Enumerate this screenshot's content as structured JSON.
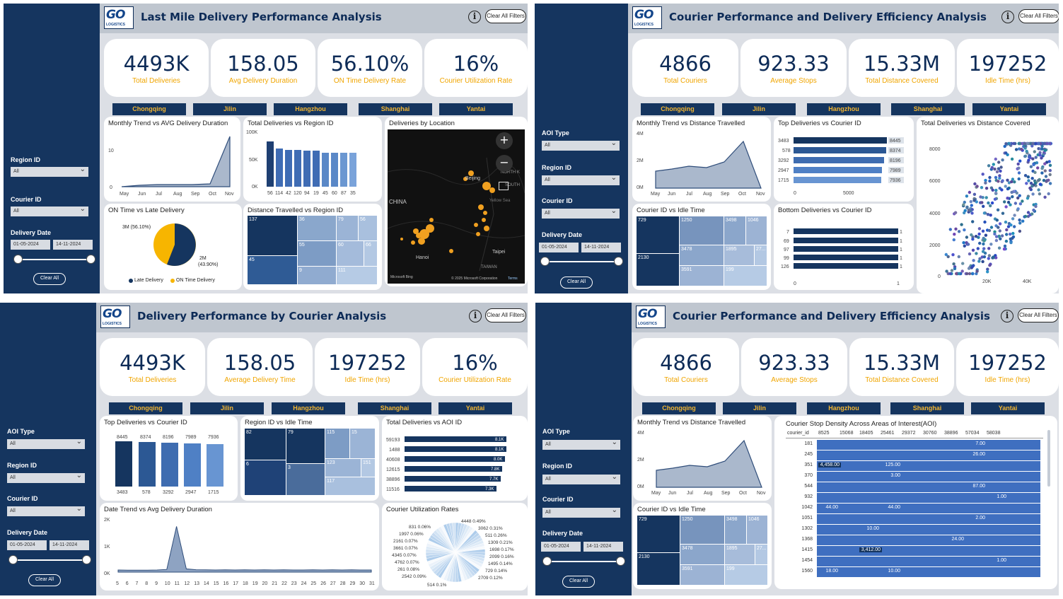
{
  "q1": {
    "title": "Last Mile Delivery Performance Analysis",
    "clear_filters": "Clear All Filters",
    "kpis": [
      {
        "value": "4493K",
        "label": "Total Deliveries"
      },
      {
        "value": "158.05",
        "label": "Avg Delivery Duration"
      },
      {
        "value": "56.10%",
        "label": "ON Time Delivery Rate"
      },
      {
        "value": "16%",
        "label": "Courier Utilization Rate"
      }
    ],
    "cities": [
      "Chongqing",
      "Jilin",
      "Hangzhou",
      "Shanghai",
      "Yantai"
    ],
    "filters": {
      "region_label": "Region ID",
      "region_value": "All",
      "courier_label": "Courier ID",
      "courier_value": "All",
      "date_label": "Delivery Date",
      "date_from": "01-05-2024",
      "date_to": "14-11-2024",
      "clear": "Clear All"
    },
    "monthly_title": "Monthly Trend vs AVG Delivery Duration",
    "region_title": "Total Deliveries vs Region ID",
    "map_title": "Deliveries by Location",
    "ontime_title": "ON Time vs Late Delivery",
    "dist_title": "Distance Travelled vs Region ID",
    "map_labels": {
      "china": "CHINA",
      "beijing": "Beijing",
      "north": "NORTH K",
      "south": "SOUTH",
      "yellow": "Yellow Sea",
      "taipei": "Taipei",
      "taiwan": "TAIWAN",
      "hanoi": "Hanoi",
      "copy": "© 2025 Microsoft Corporation",
      "terms": "Terms",
      "bing": "Microsoft Bing"
    },
    "pie": {
      "late_label": "3M (56.10%)",
      "ontime_label1": "2M",
      "ontime_label2": "(43.90%)",
      "legend_late": "Late Delivery",
      "legend_ontime": "ON Time Delivery"
    },
    "tree": {
      "a": "137",
      "b": "45",
      "c": "36",
      "d": "79",
      "e": "56",
      "f": "55",
      "g": "60",
      "h": "66",
      "i": "9",
      "j": "111"
    }
  },
  "q2": {
    "title": "Courier Performance and Delivery Efficiency Analysis",
    "clear_filters": "Clear All Filters",
    "kpis": [
      {
        "value": "4866",
        "label": "Total Couriers"
      },
      {
        "value": "923.33",
        "label": "Average Stops"
      },
      {
        "value": "15.33M",
        "label": "Total Distance Covered"
      },
      {
        "value": "197252",
        "label": "Idle Time (hrs)"
      }
    ],
    "cities": [
      "Chongqing",
      "Jilin",
      "Hangzhou",
      "Shanghai",
      "Yantai"
    ],
    "filters": {
      "aoi_label": "AOI Type",
      "aoi_value": "All",
      "region_label": "Region ID",
      "region_value": "All",
      "courier_label": "Courier ID",
      "courier_value": "All",
      "date_label": "Delivery Date",
      "date_from": "01-05-2024",
      "date_to": "14-11-2024",
      "clear": "Clear All"
    },
    "monthly_title": "Monthly Trend vs Distance Travelled",
    "top_title": "Top Deliveries vs Courier ID",
    "scatter_title": "Total Deliveries vs Distance Covered",
    "idle_title": "Courier ID vs Idle Time",
    "bottom_title": "Bottom Deliveries vs Courier ID",
    "tree": {
      "a": "729",
      "b": "2130",
      "c": "1250",
      "d": "3498",
      "e": "1046",
      "f": "3478",
      "g": "1895",
      "h": "27...",
      "i": "3591",
      "j": "199"
    }
  },
  "q3": {
    "title": "Delivery Performance by Courier Analysis",
    "clear_filters": "Clear All Filters",
    "kpis": [
      {
        "value": "4493K",
        "label": "Total Deliveries"
      },
      {
        "value": "158.05",
        "label": "Average Delivery Time"
      },
      {
        "value": "197252",
        "label": "Idle Time (hrs)"
      },
      {
        "value": "16%",
        "label": "Courier Utilization Rate"
      }
    ],
    "cities": [
      "Chongqing",
      "Jilin",
      "Hangzhou",
      "Shanghai",
      "Yantai"
    ],
    "filters": {
      "aoi_label": "AOI Type",
      "aoi_value": "All",
      "region_label": "Region ID",
      "region_value": "All",
      "courier_label": "Courier ID",
      "courier_value": "All",
      "date_label": "Delivery Date",
      "date_from": "01-05-2024",
      "date_to": "14-11-2024",
      "clear": "Clear All"
    },
    "top_title": "Top Deliveries vs Courier ID",
    "idle_title": "Region ID vs Idle Time",
    "aoi_title": "Total Deliveries vs AOI ID",
    "date_title": "Date Trend vs Avg Delivery Duration",
    "util_title": "Courier Utilization Rates",
    "tree": {
      "a": "82",
      "b": "6",
      "c": "79",
      "d": "3",
      "e": "115",
      "f": "15",
      "g": "123",
      "h": "151",
      "i": "117"
    },
    "util_labels_left": [
      "831 0.06%",
      "1997 0.06%",
      "2161 0.07%",
      "3661 0.07%",
      "4345 0.07%",
      "4762 0.07%",
      "261 0.08%",
      "2542 0.09%",
      "514 0.1%"
    ],
    "util_labels_right": [
      "4448 0.49%",
      "3062 0.31%",
      "511 0.26%",
      "1309 0.21%",
      "1698 0.17%",
      "2099 0.16%",
      "1495 0.14%",
      "729 0.14%",
      "2709 0.12%"
    ]
  },
  "q4": {
    "title": "Courier Performance and Delivery Efficiency Analysis",
    "clear_filters": "Clear All Filters",
    "kpis": [
      {
        "value": "4866",
        "label": "Total Couriers"
      },
      {
        "value": "923.33",
        "label": "Average Stops"
      },
      {
        "value": "15.33M",
        "label": "Total Distance Covered"
      },
      {
        "value": "197252",
        "label": "Idle Time (hrs)"
      }
    ],
    "cities": [
      "Chongqing",
      "Jilin",
      "Hangzhou",
      "Shanghai",
      "Yantai"
    ],
    "filters": {
      "aoi_label": "AOI Type",
      "aoi_value": "All",
      "region_label": "Region ID",
      "region_value": "All",
      "courier_label": "Courier ID",
      "courier_value": "All",
      "date_label": "Delivery Date",
      "date_from": "01-05-2024",
      "date_to": "14-11-2024",
      "clear": "Clear All"
    },
    "monthly_title": "Monthly Trend vs Distance Travelled",
    "idle_title": "Courier ID vs Idle Time",
    "matrix_title": "Courier Stop Density Across Areas of Interest(AOI)",
    "matrix_cols": [
      "courier_id",
      "8525",
      "15068",
      "18405",
      "25461",
      "29372",
      "30760",
      "38896",
      "57034",
      "58038"
    ],
    "matrix_rows": [
      {
        "id": "181",
        "cells": [
          [
            "7.00",
            8
          ]
        ]
      },
      {
        "id": "245",
        "cells": [
          [
            "26.00",
            8
          ]
        ]
      },
      {
        "id": "351",
        "cells": [
          [
            "4,458.00",
            1
          ],
          [
            "125.00",
            4
          ]
        ]
      },
      {
        "id": "370",
        "cells": [
          [
            "3.00",
            4
          ]
        ]
      },
      {
        "id": "544",
        "cells": [
          [
            "87.00",
            8
          ]
        ]
      },
      {
        "id": "932",
        "cells": [
          [
            "1.00",
            9
          ]
        ]
      },
      {
        "id": "1042",
        "cells": [
          [
            "44.00",
            1
          ],
          [
            "44.00",
            4
          ]
        ]
      },
      {
        "id": "1051",
        "cells": [
          [
            "2.00",
            8
          ]
        ]
      },
      {
        "id": "1302",
        "cells": [
          [
            "10.00",
            3
          ]
        ]
      },
      {
        "id": "1368",
        "cells": [
          [
            "24.00",
            7
          ]
        ]
      },
      {
        "id": "1415",
        "cells": [
          [
            "3,412.00",
            3
          ]
        ]
      },
      {
        "id": "1454",
        "cells": [
          [
            "1.00",
            9
          ]
        ]
      },
      {
        "id": "1560",
        "cells": [
          [
            "18.00",
            1
          ],
          [
            "10.00",
            4
          ]
        ]
      }
    ],
    "tree": {
      "a": "729",
      "b": "2130",
      "c": "1250",
      "d": "3498",
      "e": "1046",
      "f": "3478",
      "g": "1895",
      "h": "27...",
      "i": "3591",
      "j": "199"
    }
  },
  "chart_data": [
    {
      "type": "area",
      "title": "Monthly Trend vs AVG Delivery Duration",
      "categories": [
        "May",
        "Jun",
        "Jul",
        "Aug",
        "Sep",
        "Oct",
        "Nov"
      ],
      "values": [
        0.5,
        0.6,
        0.6,
        0.6,
        0.7,
        0.8,
        13
      ],
      "ylim": [
        0,
        14
      ],
      "yticks": [
        "0",
        "10"
      ]
    },
    {
      "type": "bar",
      "title": "Total Deliveries vs Region ID",
      "categories": [
        "56",
        "114",
        "42",
        "120",
        "94",
        "19",
        "45",
        "60",
        "87",
        "35"
      ],
      "values": [
        88,
        75,
        72,
        72,
        70,
        70,
        66,
        66,
        66,
        66
      ],
      "ylim": [
        0,
        100
      ],
      "yticks": [
        "0K",
        "50K",
        "100K"
      ]
    },
    {
      "type": "pie",
      "title": "ON Time vs Late Delivery",
      "values": [
        56.1,
        43.9
      ],
      "labels": [
        "Late Delivery",
        "ON Time Delivery"
      ]
    },
    {
      "type": "area",
      "title": "Monthly Trend vs Distance Travelled",
      "categories": [
        "May",
        "Jun",
        "Jul",
        "Aug",
        "Sep",
        "Oct",
        "Nov"
      ],
      "values": [
        1.3,
        1.4,
        1.6,
        1.5,
        1.8,
        2.7,
        0
      ],
      "ylim": [
        0,
        4
      ],
      "yticks": [
        "0M",
        "2M",
        "4M"
      ]
    },
    {
      "type": "bar",
      "title": "Top Deliveries vs Courier ID",
      "categories": [
        "3483",
        "578",
        "3292",
        "2947",
        "1715"
      ],
      "values": [
        8445,
        8374,
        8196,
        7989,
        7936
      ],
      "xticks": [
        "0",
        "5000"
      ]
    },
    {
      "type": "bar",
      "title": "Bottom Deliveries vs Courier ID",
      "categories": [
        "7",
        "69",
        "97",
        "99",
        "126"
      ],
      "values": [
        1,
        1,
        1,
        1,
        1
      ],
      "xticks": [
        "0",
        "1"
      ]
    },
    {
      "type": "scatter",
      "title": "Total Deliveries vs Distance Covered",
      "yticks": [
        "0",
        "2000",
        "4000",
        "6000",
        "8000"
      ],
      "xticks": [
        "20K",
        "40K"
      ]
    },
    {
      "type": "bar",
      "title": "Top Deliveries vs Courier ID",
      "categories": [
        "3483",
        "578",
        "3292",
        "2947",
        "1715"
      ],
      "values": [
        8445,
        8374,
        8196,
        7989,
        7936
      ]
    },
    {
      "type": "bar",
      "title": "Total Deliveries vs AOI ID",
      "categories": [
        "59193",
        "1488",
        "40608",
        "12615",
        "38896",
        "11516"
      ],
      "values": [
        8.1,
        8.1,
        8.0,
        7.8,
        7.7,
        7.3
      ],
      "labels": [
        "8.1K",
        "8.1K",
        "8.0K",
        "7.8K",
        "7.7K",
        "7.3K"
      ]
    },
    {
      "type": "line",
      "title": "Date Trend vs Avg Delivery Duration",
      "categories": [
        "5",
        "6",
        "7",
        "8",
        "9",
        "10",
        "11",
        "12",
        "13",
        "14",
        "15",
        "16",
        "17",
        "18",
        "19",
        "20",
        "21",
        "22",
        "23",
        "24",
        "25",
        "26",
        "27",
        "28",
        "29",
        "30",
        "31"
      ],
      "values": [
        80,
        75,
        70,
        75,
        80,
        100,
        1700,
        120,
        90,
        85,
        80,
        85,
        80,
        85,
        80,
        85,
        80,
        85,
        80,
        80,
        85,
        80,
        85,
        80,
        85,
        80,
        80
      ],
      "ylim": [
        0,
        2000
      ],
      "yticks": [
        "0K",
        "1K",
        "2K"
      ]
    }
  ]
}
